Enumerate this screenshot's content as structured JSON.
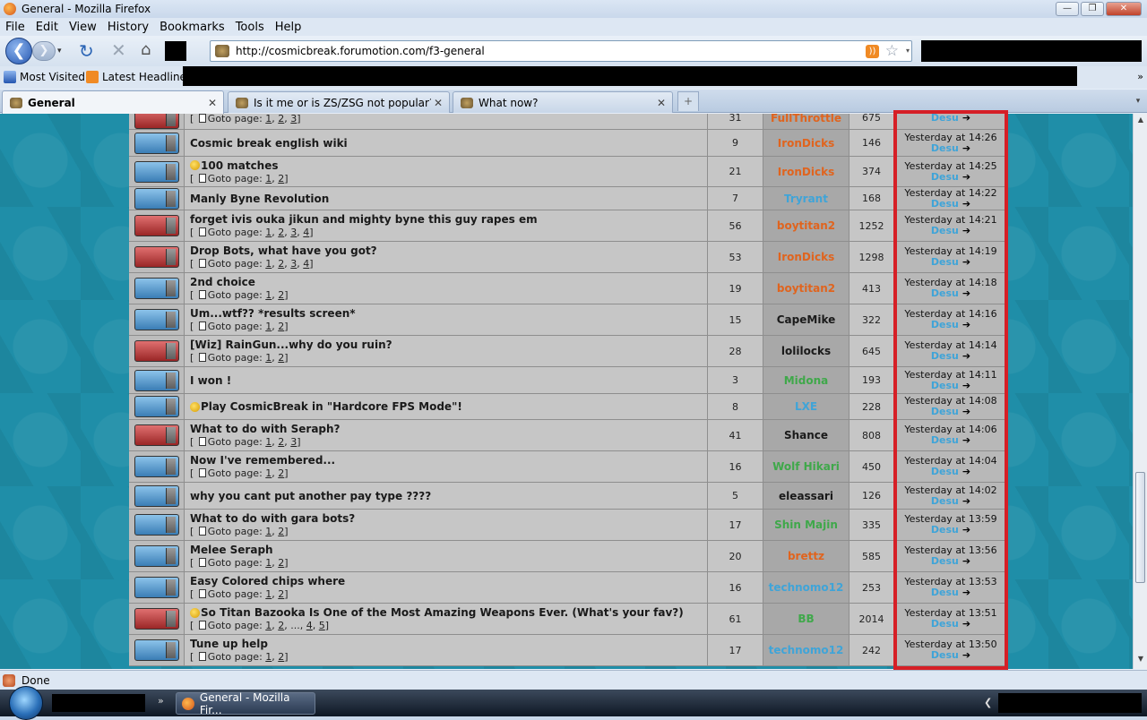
{
  "window": {
    "title": "General - Mozilla Firefox",
    "buttons": {
      "minimize": "—",
      "maximize": "❐",
      "close": "✕"
    }
  },
  "menu": [
    "File",
    "Edit",
    "View",
    "History",
    "Bookmarks",
    "Tools",
    "Help"
  ],
  "nav": {
    "url": "http://cosmicbreak.forumotion.com/f3-general",
    "back": "❮",
    "forward": "❯",
    "dropdown": "▾",
    "reload": "↻",
    "stop": "✕",
    "home": "⌂",
    "rss": "))",
    "star": "☆"
  },
  "bookmarks": {
    "items": [
      "Most Visited",
      "Latest Headlines"
    ],
    "overflow": "»"
  },
  "tabs": [
    {
      "label": "General",
      "active": true
    },
    {
      "label": "Is it me or is ZS/ZSG not popular? - ...",
      "active": false
    },
    {
      "label": "What now?",
      "active": false
    }
  ],
  "tab_close": "✕",
  "newtab": "+",
  "tablist": "▾",
  "goto_label": "Goto page:",
  "topics": [
    {
      "title": "",
      "pages": [
        "1",
        "2",
        "3"
      ],
      "replies": "31",
      "author": "FullThrottle",
      "author_color": "#e0641e",
      "views": "675",
      "last_time": "",
      "last_user": "Desu",
      "folder": "red",
      "smiley": false
    },
    {
      "title": "Cosmic break english wiki",
      "pages": [],
      "replies": "9",
      "author": "IronDicks",
      "author_color": "#e0641e",
      "views": "146",
      "last_time": "Yesterday at 14:26",
      "last_user": "Desu",
      "folder": "blue",
      "smiley": false
    },
    {
      "title": "100 matches",
      "pages": [
        "1",
        "2"
      ],
      "replies": "21",
      "author": "IronDicks",
      "author_color": "#e0641e",
      "views": "374",
      "last_time": "Yesterday at 14:25",
      "last_user": "Desu",
      "folder": "blue",
      "smiley": true
    },
    {
      "title": "Manly Byne Revolution",
      "pages": [],
      "replies": "7",
      "author": "Tryrant",
      "author_color": "#3fa4d8",
      "views": "168",
      "last_time": "Yesterday at 14:22",
      "last_user": "Desu",
      "folder": "blue",
      "smiley": false
    },
    {
      "title": "forget ivis ouka jikun and mighty byne this guy rapes em",
      "pages": [
        "1",
        "2",
        "3",
        "4"
      ],
      "replies": "56",
      "author": "boytitan2",
      "author_color": "#e0641e",
      "views": "1252",
      "last_time": "Yesterday at 14:21",
      "last_user": "Desu",
      "folder": "red",
      "smiley": false
    },
    {
      "title": "Drop Bots, what have you got?",
      "pages": [
        "1",
        "2",
        "3",
        "4"
      ],
      "replies": "53",
      "author": "IronDicks",
      "author_color": "#e0641e",
      "views": "1298",
      "last_time": "Yesterday at 14:19",
      "last_user": "Desu",
      "folder": "red",
      "smiley": false
    },
    {
      "title": "2nd choice",
      "pages": [
        "1",
        "2"
      ],
      "replies": "19",
      "author": "boytitan2",
      "author_color": "#e0641e",
      "views": "413",
      "last_time": "Yesterday at 14:18",
      "last_user": "Desu",
      "folder": "blue",
      "smiley": false
    },
    {
      "title": "Um...wtf?? *results screen*",
      "pages": [
        "1",
        "2"
      ],
      "replies": "15",
      "author": "CapeMike",
      "author_color": "#1a1a1a",
      "views": "322",
      "last_time": "Yesterday at 14:16",
      "last_user": "Desu",
      "folder": "blue",
      "smiley": false
    },
    {
      "title": "[Wiz] RainGun...why do you ruin?",
      "pages": [
        "1",
        "2"
      ],
      "replies": "28",
      "author": "lolilocks",
      "author_color": "#1a1a1a",
      "views": "645",
      "last_time": "Yesterday at 14:14",
      "last_user": "Desu",
      "folder": "red",
      "smiley": false
    },
    {
      "title": "I won !",
      "pages": [],
      "replies": "3",
      "author": "Midona",
      "author_color": "#3fa84a",
      "views": "193",
      "last_time": "Yesterday at 14:11",
      "last_user": "Desu",
      "folder": "blue",
      "smiley": false
    },
    {
      "title": "Play CosmicBreak in \"Hardcore FPS Mode\"!",
      "pages": [],
      "replies": "8",
      "author": "LXE",
      "author_color": "#3fa4d8",
      "views": "228",
      "last_time": "Yesterday at 14:08",
      "last_user": "Desu",
      "folder": "blue",
      "smiley": true
    },
    {
      "title": "What to do with Seraph?",
      "pages": [
        "1",
        "2",
        "3"
      ],
      "replies": "41",
      "author": "Shance",
      "author_color": "#1a1a1a",
      "views": "808",
      "last_time": "Yesterday at 14:06",
      "last_user": "Desu",
      "folder": "red",
      "smiley": false
    },
    {
      "title": "Now I've remembered...",
      "pages": [
        "1",
        "2"
      ],
      "replies": "16",
      "author": "Wolf Hikari",
      "author_color": "#3fa84a",
      "views": "450",
      "last_time": "Yesterday at 14:04",
      "last_user": "Desu",
      "folder": "blue",
      "smiley": false
    },
    {
      "title": "why you cant put another pay type ????",
      "pages": [],
      "replies": "5",
      "author": "eleassari",
      "author_color": "#1a1a1a",
      "views": "126",
      "last_time": "Yesterday at 14:02",
      "last_user": "Desu",
      "folder": "blue",
      "smiley": false
    },
    {
      "title": "What to do with gara bots?",
      "pages": [
        "1",
        "2"
      ],
      "replies": "17",
      "author": "Shin Majin",
      "author_color": "#3fa84a",
      "views": "335",
      "last_time": "Yesterday at 13:59",
      "last_user": "Desu",
      "folder": "blue",
      "smiley": false
    },
    {
      "title": "Melee Seraph",
      "pages": [
        "1",
        "2"
      ],
      "replies": "20",
      "author": "brettz",
      "author_color": "#e0641e",
      "views": "585",
      "last_time": "Yesterday at 13:56",
      "last_user": "Desu",
      "folder": "blue",
      "smiley": false
    },
    {
      "title": "Easy Colored chips where",
      "pages": [
        "1",
        "2"
      ],
      "replies": "16",
      "author": "technomo12",
      "author_color": "#3fa4d8",
      "views": "253",
      "last_time": "Yesterday at 13:53",
      "last_user": "Desu",
      "folder": "blue",
      "smiley": false
    },
    {
      "title": "So Titan Bazooka Is One of the Most Amazing Weapons Ever. (What's your fav?)",
      "pages": [
        "1",
        "2",
        "...",
        "4",
        "5"
      ],
      "replies": "61",
      "author": "BB",
      "author_color": "#3fa84a",
      "views": "2014",
      "last_time": "Yesterday at 13:51",
      "last_user": "Desu",
      "folder": "red",
      "smiley": true
    },
    {
      "title": "Tune up help",
      "pages": [
        "1",
        "2"
      ],
      "replies": "17",
      "author": "technomo12",
      "author_color": "#3fa4d8",
      "views": "242",
      "last_time": "Yesterday at 13:50",
      "last_user": "Desu",
      "folder": "blue",
      "smiley": false
    }
  ],
  "scrollbar": {
    "up": "▲",
    "down": "▼"
  },
  "status": {
    "text": "Done"
  },
  "taskbar": {
    "task_label": "General - Mozilla Fir...",
    "quick_arrows": "»",
    "tray_arrow": "❮"
  },
  "colors": {
    "accent": "#2456b0",
    "highlight_border": "#d61f26",
    "link_blue": "#3fa4d8",
    "author_orange": "#e0641e",
    "author_green": "#3fa84a"
  }
}
